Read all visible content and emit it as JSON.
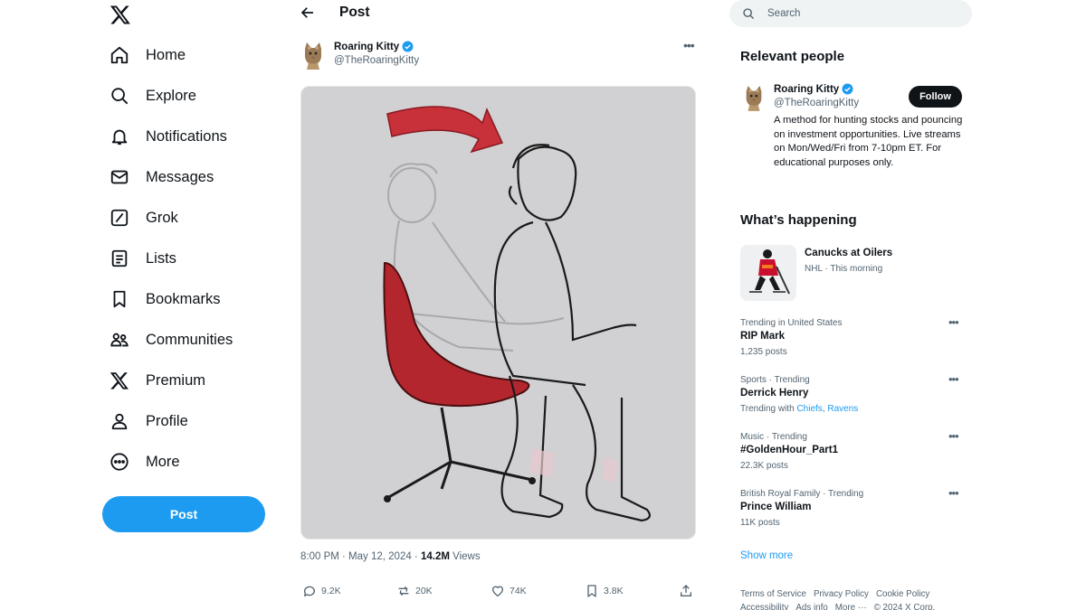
{
  "nav": {
    "items": [
      {
        "label": "Home",
        "icon": "home-icon"
      },
      {
        "label": "Explore",
        "icon": "search-icon"
      },
      {
        "label": "Notifications",
        "icon": "bell-icon"
      },
      {
        "label": "Messages",
        "icon": "mail-icon"
      },
      {
        "label": "Grok",
        "icon": "grok-icon"
      },
      {
        "label": "Lists",
        "icon": "list-icon"
      },
      {
        "label": "Bookmarks",
        "icon": "bookmark-icon"
      },
      {
        "label": "Communities",
        "icon": "communities-icon"
      },
      {
        "label": "Premium",
        "icon": "x-logo-icon"
      },
      {
        "label": "Profile",
        "icon": "person-icon"
      },
      {
        "label": "More",
        "icon": "more-circle-icon"
      }
    ],
    "post_button": "Post"
  },
  "post": {
    "header_title": "Post",
    "author_name": "Roaring Kitty",
    "author_handle": "@TheRoaringKitty",
    "time": "8:00 PM · May 12, 2024 · ",
    "views_count": "14.2M",
    "views_label": " Views",
    "replies": "9.2K",
    "reposts": "20K",
    "likes": "74K",
    "bookmarks": "3.8K"
  },
  "search": {
    "placeholder": "Search"
  },
  "relevant": {
    "title": "Relevant people",
    "name": "Roaring Kitty",
    "handle": "@TheRoaringKitty",
    "follow": "Follow",
    "bio": "A method for hunting stocks and pouncing on investment opportunities. Live streams on Mon/Wed/Fri from 7-10pm ET. For educational purposes only."
  },
  "happening": {
    "title": "What’s happening",
    "event_title": "Canucks at Oilers",
    "event_sub": "NHL · This morning",
    "trends": [
      {
        "context": "Trending in United States",
        "name": "RIP Mark",
        "count": "1,235 posts"
      },
      {
        "context": "Sports · Trending",
        "name": "Derrick Henry",
        "count_prefix": "Trending with ",
        "link1": "Chiefs",
        "sep": ", ",
        "link2": "Ravens"
      },
      {
        "context": "Music · Trending",
        "name": "#GoldenHour_Part1",
        "count": "22.3K posts"
      },
      {
        "context": "British Royal Family · Trending",
        "name": "Prince William",
        "count": "11K posts"
      }
    ],
    "show_more": "Show more"
  },
  "footer": {
    "links": [
      "Terms of Service",
      "Privacy Policy",
      "Cookie Policy",
      "Accessibility",
      "Ads info",
      "More ···",
      "© 2024 X Corp."
    ]
  },
  "colors": {
    "accent": "#1d9bf0",
    "text": "#0f1419",
    "muted": "#536471",
    "chair_red": "#b3262e"
  }
}
